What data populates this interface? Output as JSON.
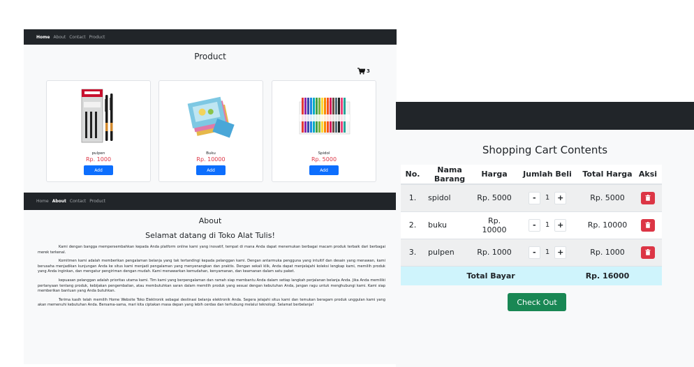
{
  "product_page": {
    "nav": [
      "Home",
      "About",
      "Contact",
      "Product"
    ],
    "active_nav": "Home",
    "title": "Product",
    "cart_count": "3",
    "products": [
      {
        "name": "pulpen",
        "price": "Rp. 1000",
        "button": "Add",
        "image": "pen-box-image"
      },
      {
        "name": "Buku",
        "price": "Rp. 10000",
        "button": "Add",
        "image": "notebooks-image"
      },
      {
        "name": "Spidol",
        "price": "Rp. 5000",
        "button": "Add",
        "image": "markers-image"
      }
    ]
  },
  "about_page": {
    "nav": [
      "Home",
      "About",
      "Contact",
      "Product"
    ],
    "active_nav": "About",
    "title": "About",
    "welcome": "Selamat datang di Toko Alat Tulis!",
    "paragraphs": [
      "Kami dengan bangga mempersembahkan kepada Anda platform online kami yang inovatif, tempat di mana Anda dapat menemukan berbagai macam produk terbaik dari berbagai merek terkenal.",
      "Komitmen kami adalah memberikan pengalaman belanja yang tak tertandingi kepada pelanggan kami. Dengan antarmuka pengguna yang intuitif dan desain yang menawan, kami berusaha menjadikan kunjungan Anda ke situs kami menjadi pengalaman yang menyenangkan dan praktis. Dengan sekali klik, Anda dapat menjelajahi koleksi lengkap kami, memilih produk yang Anda inginkan, dan mengatur pengiriman dengan mudah. Kami menawarkan kemudahan, kenyamanan, dan keamanan dalam satu paket.",
      "kepuasan pelanggan adalah prioritas utama kami. Tim kami yang berpengalaman dan ramah siap membantu Anda dalam setiap langkah perjalanan belanja Anda. Jika Anda memiliki pertanyaan tentang produk, kebijakan pengembalian, atau membutuhkan saran dalam memilih produk yang sesuai dengan kebutuhan Anda, jangan ragu untuk menghubungi kami. Kami siap memberikan bantuan yang Anda butuhkan.",
      "Terima kasih telah memilih Home Website Toko Elektronik sebagai destinasi belanja elektronik Anda. Segera jelajahi situs kami dan temukan beragam produk unggulan kami yang akan memenuhi kebutuhan Anda. Bersama-sama, mari kita ciptakan masa depan yang lebih cerdas dan terhubung melalui teknologi. Selamat berbelanja!"
    ]
  },
  "cart_page": {
    "title": "Shopping Cart Contents",
    "columns": [
      "No.",
      "Nama Barang",
      "Harga",
      "Jumlah Beli",
      "Total Harga",
      "Aksi"
    ],
    "rows": [
      {
        "no": "1.",
        "name": "spidol",
        "price": "Rp. 5000",
        "qty": "1",
        "total": "Rp. 5000"
      },
      {
        "no": "2.",
        "name": "buku",
        "price": "Rp. 10000",
        "qty": "1",
        "total": "Rp. 10000"
      },
      {
        "no": "3.",
        "name": "pulpen",
        "price": "Rp. 1000",
        "qty": "1",
        "total": "Rp. 1000"
      }
    ],
    "minus_label": "-",
    "plus_label": "+",
    "total_label": "Total Bayar",
    "total_value": "Rp. 16000",
    "checkout_label": "Check Out"
  },
  "colors": {
    "navbar": "#212529",
    "primary": "#0d6efd",
    "danger": "#dc3545",
    "success": "#198754",
    "total_row": "#cff4fc"
  }
}
